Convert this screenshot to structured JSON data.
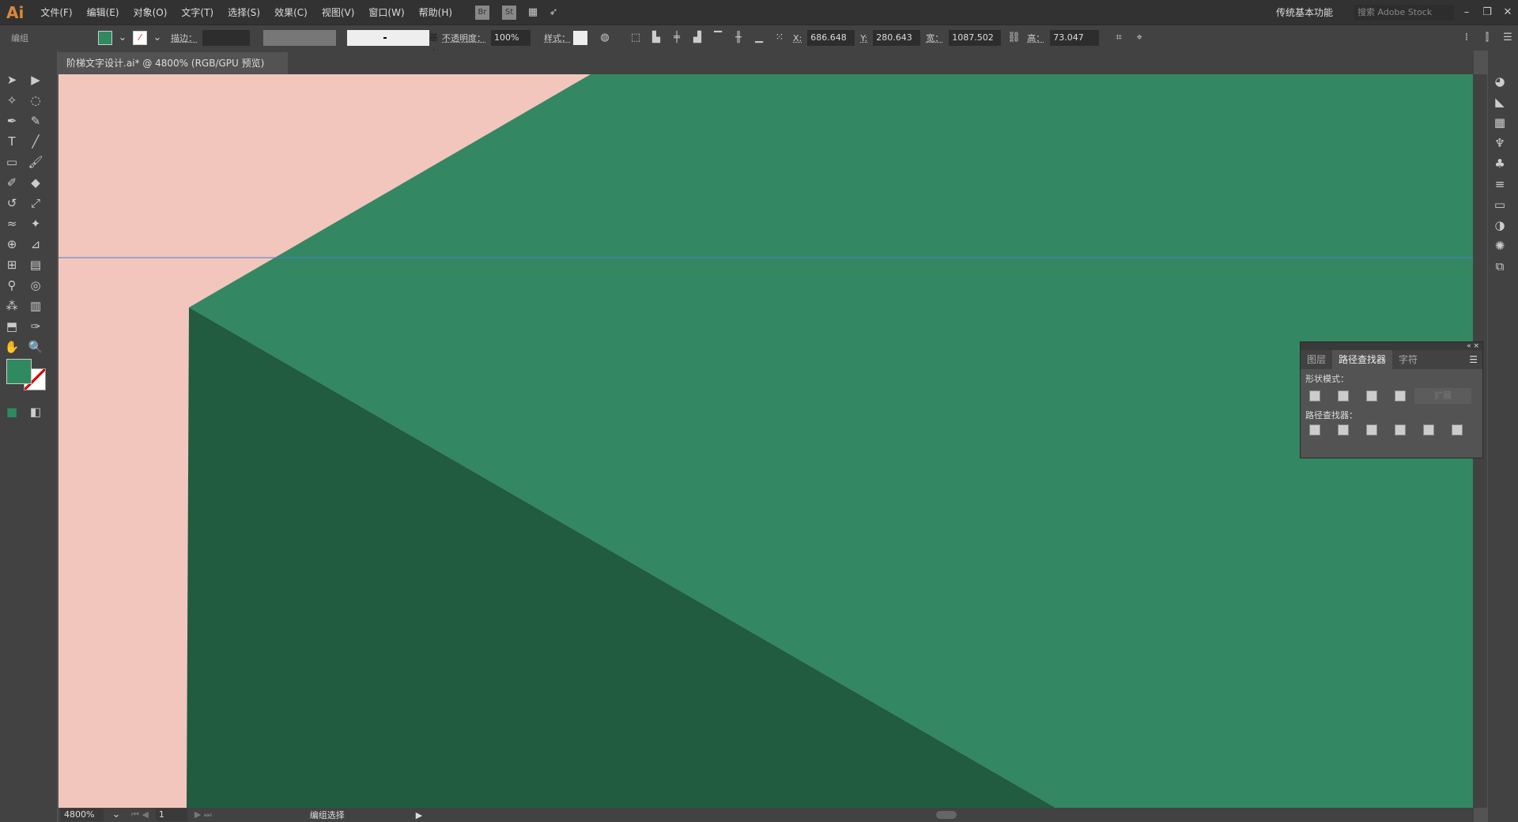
{
  "app": {
    "logo": "Ai",
    "workspace": "传统基本功能",
    "search_placeholder": "搜索 Adobe Stock"
  },
  "menu": [
    "文件(F)",
    "编辑(E)",
    "对象(O)",
    "文字(T)",
    "选择(S)",
    "效果(C)",
    "视图(V)",
    "窗口(W)",
    "帮助(H)"
  ],
  "bridge": {
    "br": "Br",
    "st": "St"
  },
  "control": {
    "selection": "编组",
    "fill_color": "#2f8a60",
    "stroke_label": "描边：",
    "stroke_profile": "基本",
    "opacity_label": "不透明度：",
    "opacity": "100%",
    "style_label": "样式：",
    "x_label": "X:",
    "x": "686.648 px",
    "y_label": "Y:",
    "y": "280.643 px",
    "w_label": "宽：",
    "w": "1087.502",
    "h_label": "高：",
    "h": "73.047 px"
  },
  "document": {
    "tab": "阶梯文字设计.ai* @ 4800% (RGB/GPU 预览)",
    "close": "×"
  },
  "canvas": {
    "background": "#f2c6bc",
    "light_green": "#338762",
    "dark_green": "#215b40",
    "guide": "#4a7fd6"
  },
  "panel": {
    "tabs": [
      "图层",
      "路径查找器",
      "字符"
    ],
    "active_tab": 1,
    "shape_modes_label": "形状模式：",
    "expand": "扩展",
    "pathfinders_label": "路径查找器："
  },
  "status": {
    "zoom": "4800%",
    "artboard": "1",
    "mode": "编组选择"
  }
}
